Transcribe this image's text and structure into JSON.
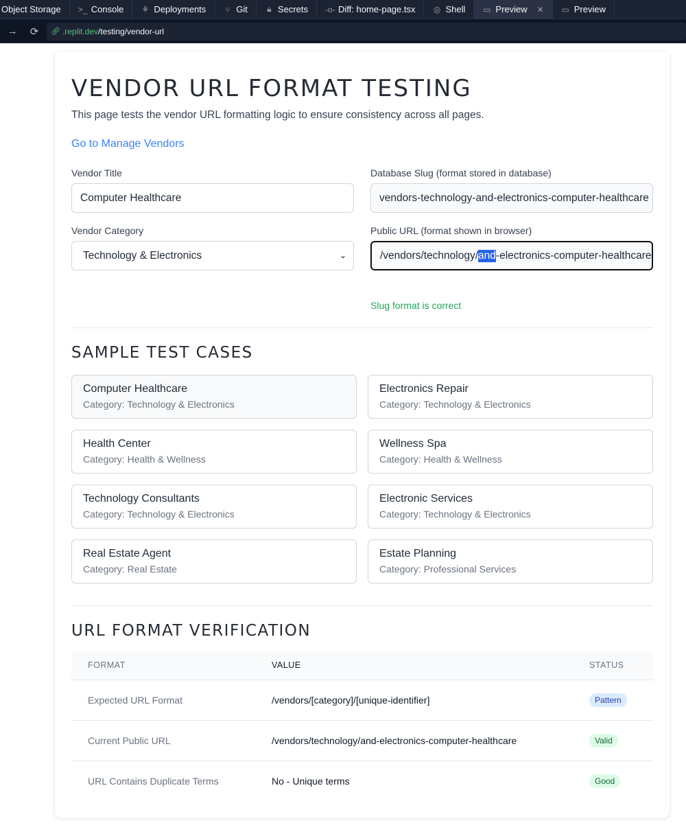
{
  "tabs": [
    {
      "label": "Object Storage",
      "icon": "",
      "active": false
    },
    {
      "label": "Console",
      "icon": "console-icon",
      "active": false
    },
    {
      "label": "Deployments",
      "icon": "deployments-icon",
      "active": false
    },
    {
      "label": "Git",
      "icon": "git-icon",
      "active": false
    },
    {
      "label": "Secrets",
      "icon": "lock-icon",
      "active": false
    },
    {
      "label": "Diff: home-page.tsx",
      "icon": "diff-icon",
      "active": false
    },
    {
      "label": "Shell",
      "icon": "shell-icon",
      "active": false
    },
    {
      "label": "Preview",
      "icon": "monitor-icon",
      "active": true
    },
    {
      "label": "Preview",
      "icon": "monitor-icon",
      "active": false
    }
  ],
  "address": {
    "host": ".replit.dev",
    "path": "/testing/vendor-url"
  },
  "page": {
    "title": "Vendor URL Format Testing",
    "description": "This page tests the vendor URL formatting logic to ensure consistency across all pages.",
    "manage_link": "Go to Manage Vendors"
  },
  "form": {
    "vendor_title_label": "Vendor Title",
    "vendor_title_value": "Computer Healthcare",
    "vendor_category_label": "Vendor Category",
    "vendor_category_value": "Technology & Electronics",
    "db_slug_label": "Database Slug (format stored in database)",
    "db_slug_value": "vendors-technology-and-electronics-computer-healthcare",
    "public_url_label": "Public URL (format shown in browser)",
    "public_url_before": "/vendors/technology/",
    "public_url_selected": "and",
    "public_url_after": "-electronics-computer-healthcare",
    "status_message": "Slug format is correct"
  },
  "samples": {
    "heading": "Sample Test Cases",
    "items": [
      {
        "title": "Computer Healthcare",
        "category": "Category: Technology & Electronics"
      },
      {
        "title": "Electronics Repair",
        "category": "Category: Technology & Electronics"
      },
      {
        "title": "Health Center",
        "category": "Category: Health & Wellness"
      },
      {
        "title": "Wellness Spa",
        "category": "Category: Health & Wellness"
      },
      {
        "title": "Technology Consultants",
        "category": "Category: Technology & Electronics"
      },
      {
        "title": "Electronic Services",
        "category": "Category: Technology & Electronics"
      },
      {
        "title": "Real Estate Agent",
        "category": "Category: Real Estate"
      },
      {
        "title": "Estate Planning",
        "category": "Category: Professional Services"
      }
    ]
  },
  "verification": {
    "heading": "URL Format Verification",
    "columns": [
      "Format",
      "Value",
      "Status"
    ],
    "rows": [
      {
        "format": "Expected URL Format",
        "value": "/vendors/[category]/[unique-identifier]",
        "status": "Pattern",
        "status_color": "#1e40af"
      },
      {
        "format": "Current Public URL",
        "value": "/vendors/technology/and-electronics-computer-healthcare",
        "status": "Valid",
        "status_color": "#166534"
      },
      {
        "format": "URL Contains Duplicate Terms",
        "value": "No - Unique terms",
        "status": "Good",
        "status_color": "#166534"
      }
    ]
  }
}
